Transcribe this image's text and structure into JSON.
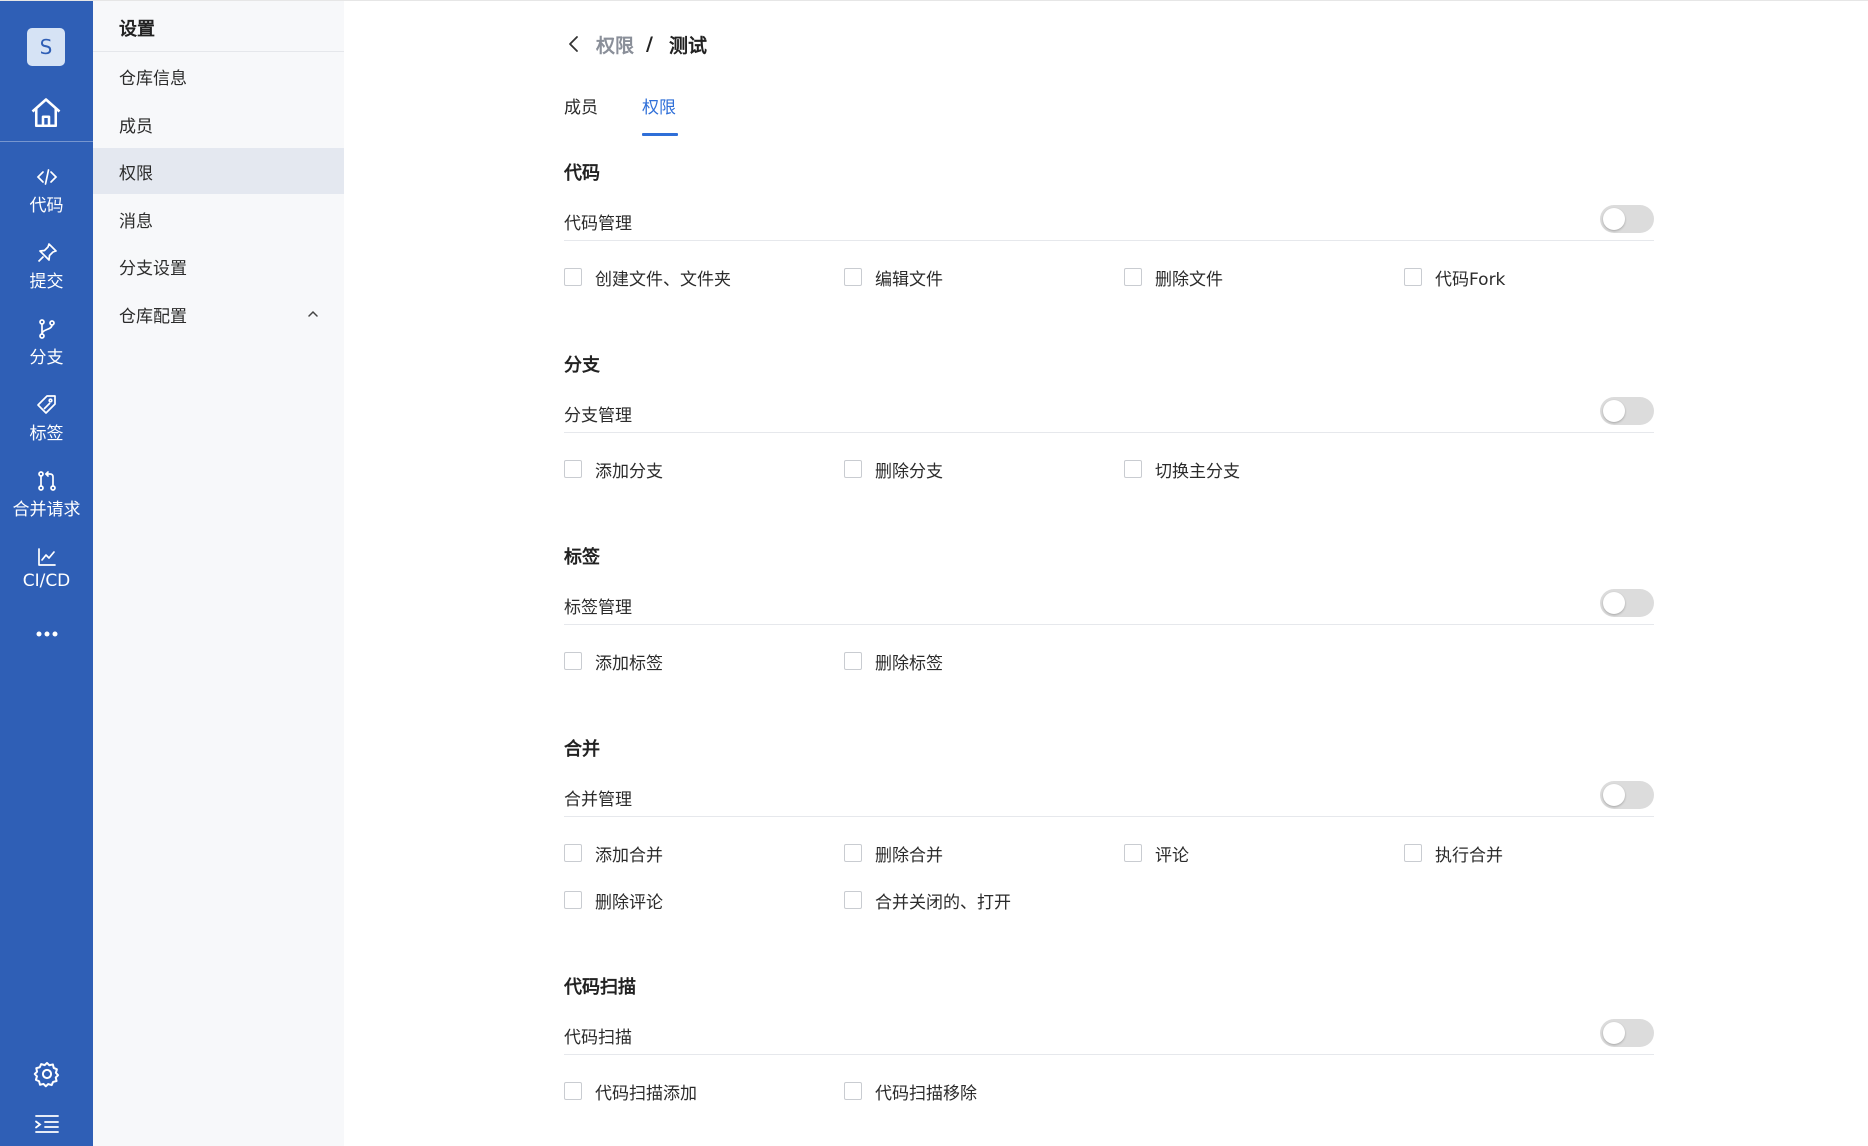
{
  "rail": {
    "avatar": "S",
    "items": [
      {
        "label": "代码",
        "icon": "code-icon"
      },
      {
        "label": "提交",
        "icon": "pin-icon"
      },
      {
        "label": "分支",
        "icon": "branch-icon"
      },
      {
        "label": "标签",
        "icon": "tag-icon"
      },
      {
        "label": "合并请求",
        "icon": "merge-request-icon"
      },
      {
        "label": "CI/CD",
        "icon": "chart-icon"
      }
    ]
  },
  "subnav": {
    "title": "设置",
    "items": [
      {
        "label": "仓库信息"
      },
      {
        "label": "成员"
      },
      {
        "label": "权限",
        "active": true
      },
      {
        "label": "消息"
      },
      {
        "label": "分支设置"
      },
      {
        "label": "仓库配置",
        "expandable": true
      }
    ]
  },
  "breadcrumb": {
    "parent": "权限",
    "separator": "/",
    "current": "测试"
  },
  "tabs": [
    {
      "label": "成员",
      "active": false
    },
    {
      "label": "权限",
      "active": true
    }
  ],
  "sections": [
    {
      "title": "代码",
      "manage_label": "代码管理",
      "enabled": false,
      "options": [
        "创建文件、文件夹",
        "编辑文件",
        "删除文件",
        "代码Fork"
      ]
    },
    {
      "title": "分支",
      "manage_label": "分支管理",
      "enabled": false,
      "options": [
        "添加分支",
        "删除分支",
        "切换主分支"
      ]
    },
    {
      "title": "标签",
      "manage_label": "标签管理",
      "enabled": false,
      "options": [
        "添加标签",
        "删除标签"
      ]
    },
    {
      "title": "合并",
      "manage_label": "合并管理",
      "enabled": false,
      "options": [
        "添加合并",
        "删除合并",
        "评论",
        "执行合并",
        "删除评论",
        "合并关闭的、打开"
      ]
    },
    {
      "title": "代码扫描",
      "manage_label": "代码扫描",
      "enabled": false,
      "options": [
        "代码扫描添加",
        "代码扫描移除"
      ]
    }
  ],
  "colors": {
    "rail": "#2f5fb6",
    "accent": "#2f6fd8",
    "toggle_off": "#dcdcdc"
  }
}
